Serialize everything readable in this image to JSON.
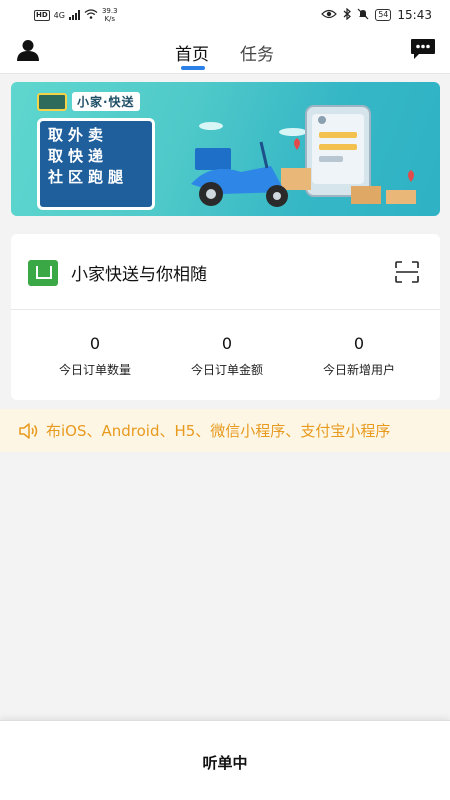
{
  "status_bar": {
    "hd": "HD",
    "network": "4G",
    "speed_value": "39.3",
    "speed_unit": "K/s",
    "battery": "54",
    "time": "15:43"
  },
  "nav": {
    "tabs": [
      {
        "label": "首页",
        "active": true
      },
      {
        "label": "任务",
        "active": false
      }
    ],
    "accent_color": "#2b80e8"
  },
  "banner": {
    "brand": "小家·快送",
    "slogan": [
      "取外卖",
      "取快递",
      "社区跑腿"
    ]
  },
  "card": {
    "title": "小家快送与你相随",
    "stats": [
      {
        "value": "0",
        "label": "今日订单数量"
      },
      {
        "value": "0",
        "label": "今日订单金额"
      },
      {
        "value": "0",
        "label": "今日新增用户"
      }
    ]
  },
  "notice": {
    "text": "布iOS、Android、H5、微信小程序、支付宝小程序",
    "color": "#e89a1f"
  },
  "bottom": {
    "label": "听单中"
  }
}
